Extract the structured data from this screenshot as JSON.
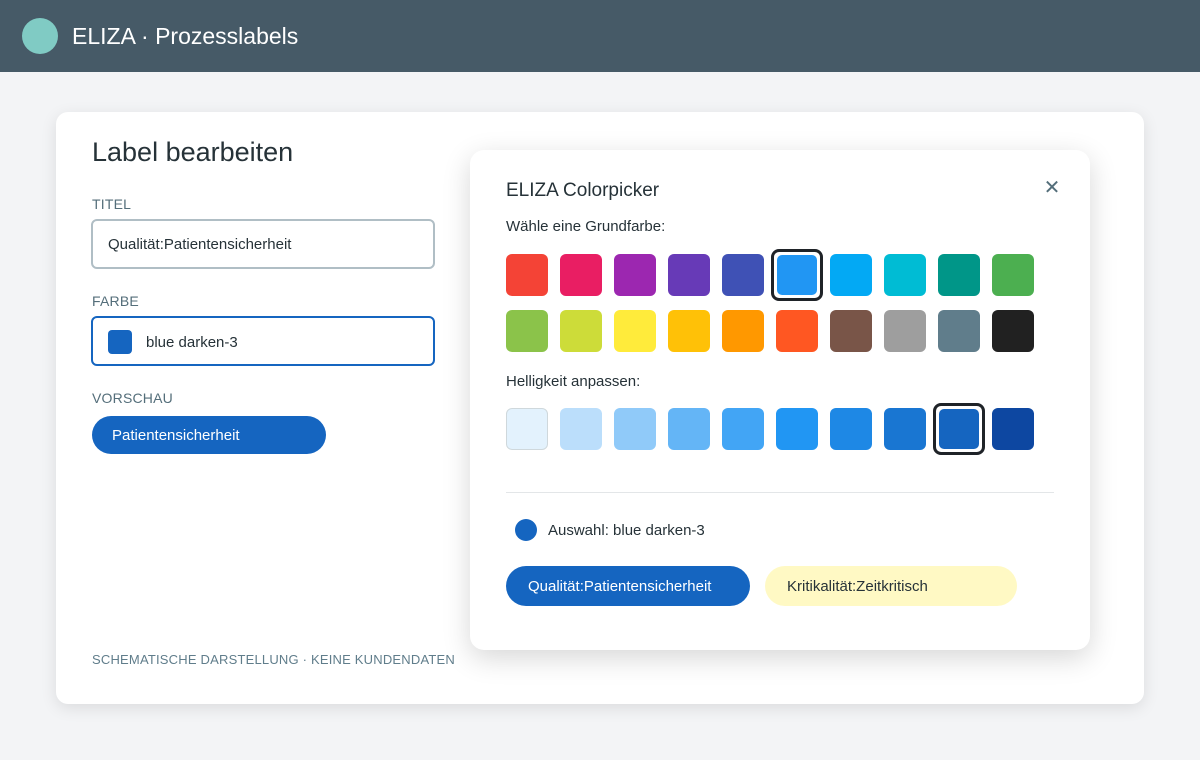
{
  "app": {
    "title": "ELIZA · Prozesslabels",
    "logo_color": "#80cbc4"
  },
  "editor": {
    "heading": "Label bearbeiten",
    "title_label": "TITEL",
    "title_value": "Qualität:Patientensicherheit",
    "color_label": "FARBE",
    "color_value": "blue darken-3",
    "color_hex": "#1565c0",
    "preview_label": "VORSCHAU",
    "preview_text": "Patientensicherheit",
    "footnote": "SCHEMATISCHE DARSTELLUNG · KEINE KUNDENDATEN"
  },
  "picker": {
    "title": "ELIZA Colorpicker",
    "close_glyph": "✕",
    "base_label": "Wähle eine Grundfarbe:",
    "base_colors": [
      "#f44336",
      "#e91e63",
      "#9c27b0",
      "#673ab7",
      "#3f51b5",
      "#2196f3",
      "#03a9f4",
      "#00bcd4",
      "#009688",
      "#4caf50",
      "#8bc34a",
      "#cddc39",
      "#ffeb3b",
      "#ffc107",
      "#ff9800",
      "#ff5722",
      "#795548",
      "#9e9e9e",
      "#607d8b",
      "#212121"
    ],
    "base_selected": 5,
    "shade_label": "Helligkeit anpassen:",
    "shades": [
      "#e3f2fd",
      "#bbdefb",
      "#90caf9",
      "#64b5f6",
      "#42a5f5",
      "#2196f3",
      "#1e88e5",
      "#1976d2",
      "#1565c0",
      "#0d47a1"
    ],
    "shade_selected": 8,
    "selection_text": "Auswahl: blue darken-3",
    "examples": [
      {
        "text": "Qualität:Patientensicherheit",
        "bg": "#1565c0"
      },
      {
        "text": "Kritikalität:Zeitkritisch",
        "bg": "#fff9c4"
      }
    ]
  }
}
